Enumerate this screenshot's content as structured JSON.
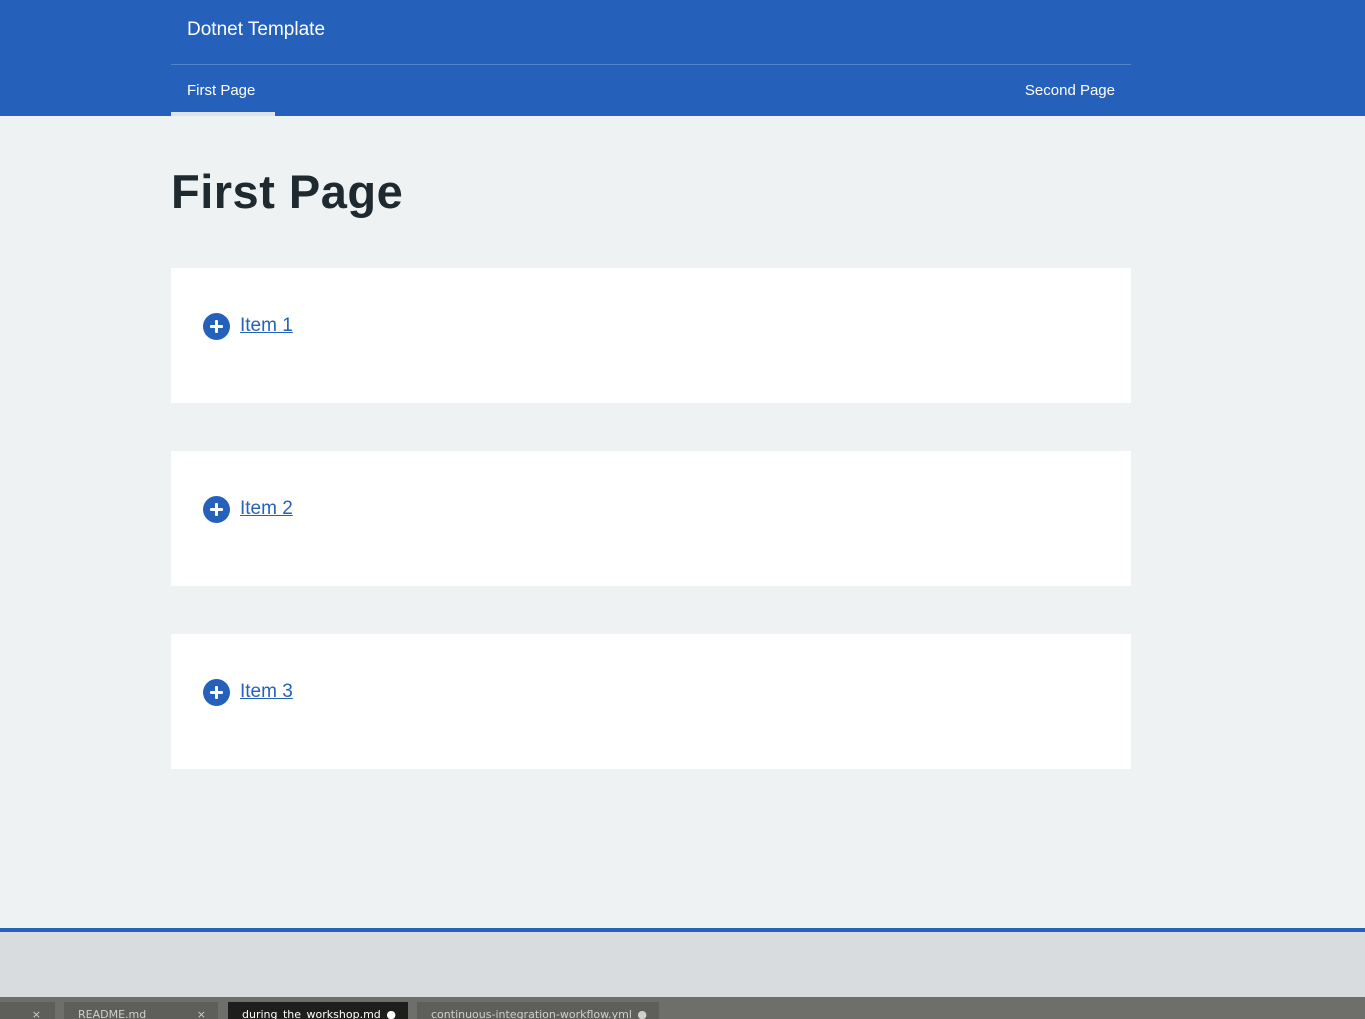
{
  "header": {
    "app_title": "Dotnet Template",
    "nav": [
      {
        "label": "First Page",
        "active": true
      },
      {
        "label": "Second Page",
        "active": false
      }
    ]
  },
  "main": {
    "title": "First Page",
    "items": [
      {
        "label": "Item 1",
        "icon": "plus-circle-icon"
      },
      {
        "label": "Item 2",
        "icon": "plus-circle-icon"
      },
      {
        "label": "Item 3",
        "icon": "plus-circle-icon"
      }
    ]
  },
  "editor_tabs": [
    {
      "label": "",
      "close": "×"
    },
    {
      "label": "README.md",
      "close": "×"
    },
    {
      "label": "during_the_workshop.md",
      "close": "●",
      "active": true
    },
    {
      "label": "continuous-integration-workflow.yml",
      "close": "●"
    }
  ],
  "colors": {
    "brand": "#2561bb",
    "background": "#eef2f3",
    "card": "#ffffff",
    "title_text": "#1f2a30"
  }
}
